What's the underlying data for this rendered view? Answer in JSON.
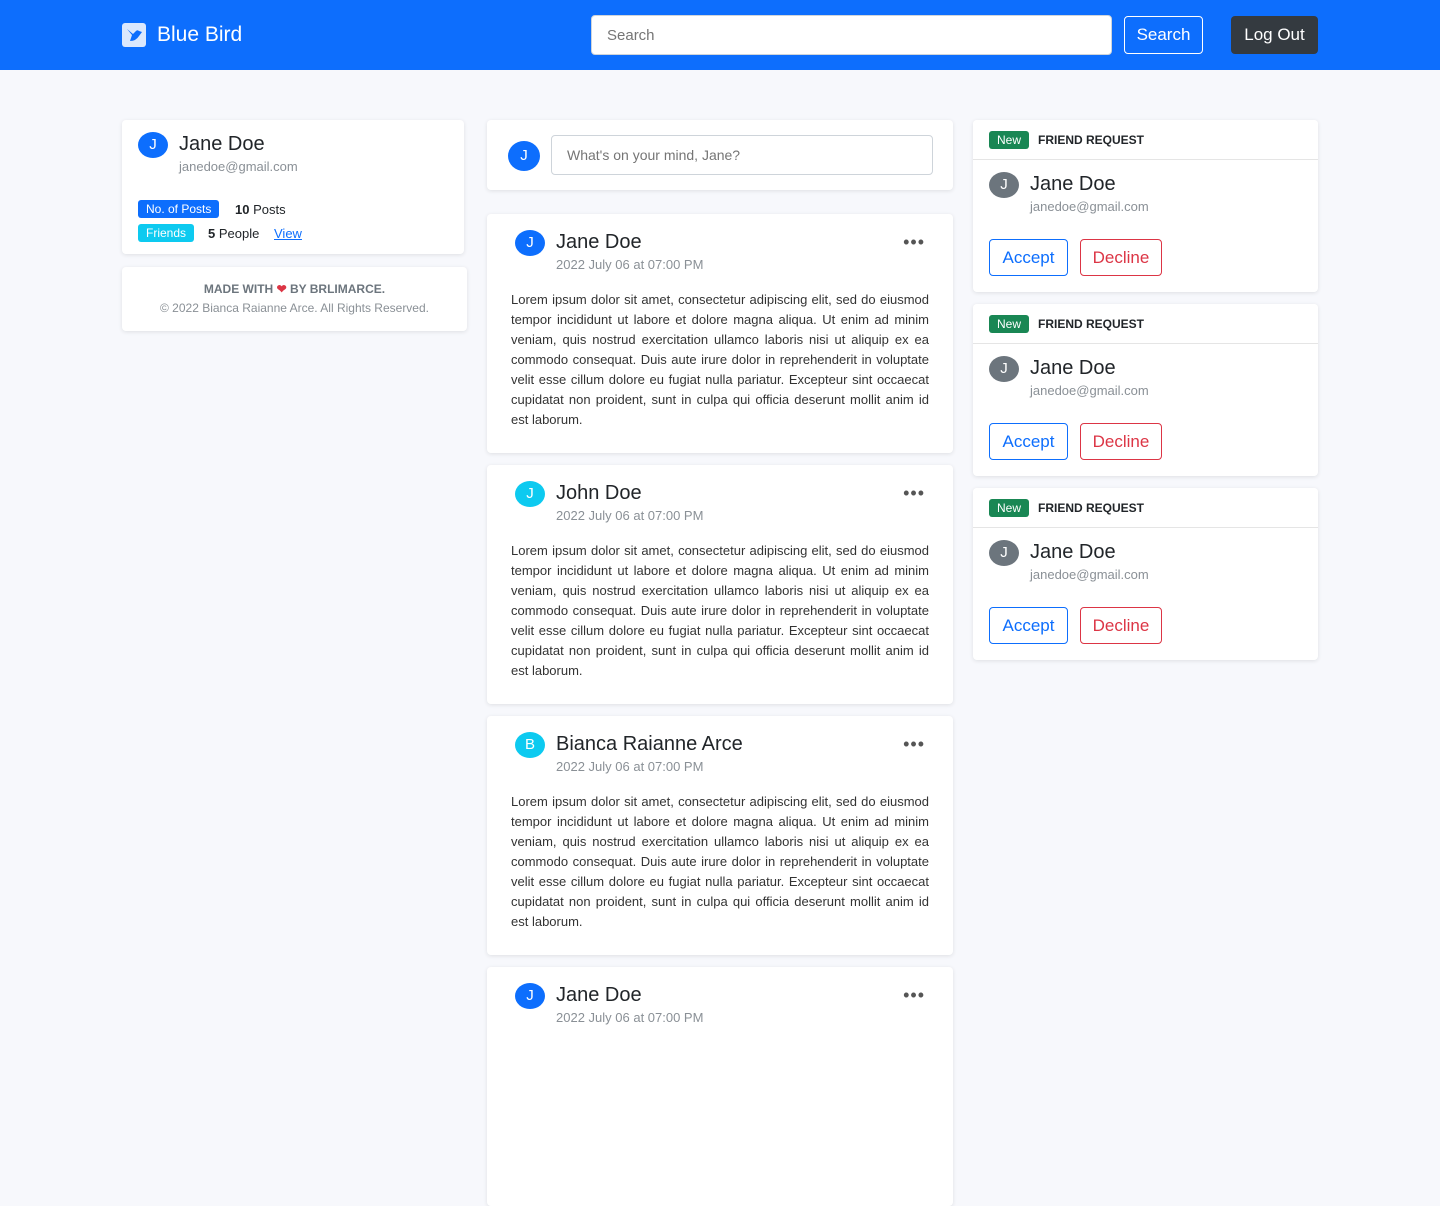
{
  "nav": {
    "brand": "Blue Bird",
    "search_placeholder": "Search",
    "search_button": "Search",
    "logout": "Log Out"
  },
  "profile": {
    "initial": "J",
    "name": "Jane Doe",
    "email": "janedoe@gmail.com",
    "posts_label": "No. of Posts",
    "posts_count": "10",
    "posts_unit": "Posts",
    "friends_label": "Friends",
    "friends_count": "5",
    "friends_unit": "People",
    "view": "View"
  },
  "footer": {
    "made_with": "MADE WITH",
    "by": "BY BRLIMARCE.",
    "copyright": "© 2022 Bianca Raianne Arce. All Rights Reserved."
  },
  "composer": {
    "initial": "J",
    "placeholder": "What's on your mind, Jane?"
  },
  "posts": [
    {
      "initial": "J",
      "color": "#0d6efd",
      "name": "Jane Doe",
      "date": "2022 July 06 at 07:00 PM",
      "body": "Lorem ipsum dolor sit amet, consectetur adipiscing elit, sed do eiusmod tempor incididunt ut labore et dolore magna aliqua. Ut enim ad minim veniam, quis nostrud exercitation ullamco laboris nisi ut aliquip ex ea commodo consequat. Duis aute irure dolor in reprehenderit in voluptate velit esse cillum dolore eu fugiat nulla pariatur. Excepteur sint occaecat cupidatat non proident, sunt in culpa qui officia deserunt mollit anim id est laborum."
    },
    {
      "initial": "J",
      "color": "#0dcaf0",
      "name": "John Doe",
      "date": "2022 July 06 at 07:00 PM",
      "body": "Lorem ipsum dolor sit amet, consectetur adipiscing elit, sed do eiusmod tempor incididunt ut labore et dolore magna aliqua. Ut enim ad minim veniam, quis nostrud exercitation ullamco laboris nisi ut aliquip ex ea commodo consequat. Duis aute irure dolor in reprehenderit in voluptate velit esse cillum dolore eu fugiat nulla pariatur. Excepteur sint occaecat cupidatat non proident, sunt in culpa qui officia deserunt mollit anim id est laborum."
    },
    {
      "initial": "B",
      "color": "#0dcaf0",
      "name": "Bianca Raianne Arce",
      "date": "2022 July 06 at 07:00 PM",
      "body": "Lorem ipsum dolor sit amet, consectetur adipiscing elit, sed do eiusmod tempor incididunt ut labore et dolore magna aliqua. Ut enim ad minim veniam, quis nostrud exercitation ullamco laboris nisi ut aliquip ex ea commodo consequat. Duis aute irure dolor in reprehenderit in voluptate velit esse cillum dolore eu fugiat nulla pariatur. Excepteur sint occaecat cupidatat non proident, sunt in culpa qui officia deserunt mollit anim id est laborum."
    },
    {
      "initial": "J",
      "color": "#0d6efd",
      "name": "Jane Doe",
      "date": "2022 July 06 at 07:00 PM",
      "body": ""
    }
  ],
  "requests": [
    {
      "badge": "New",
      "title": "FRIEND REQUEST",
      "initial": "J",
      "name": "Jane Doe",
      "email": "janedoe@gmail.com",
      "accept": "Accept",
      "decline": "Decline"
    },
    {
      "badge": "New",
      "title": "FRIEND REQUEST",
      "initial": "J",
      "name": "Jane Doe",
      "email": "janedoe@gmail.com",
      "accept": "Accept",
      "decline": "Decline"
    },
    {
      "badge": "New",
      "title": "FRIEND REQUEST",
      "initial": "J",
      "name": "Jane Doe",
      "email": "janedoe@gmail.com",
      "accept": "Accept",
      "decline": "Decline"
    }
  ]
}
